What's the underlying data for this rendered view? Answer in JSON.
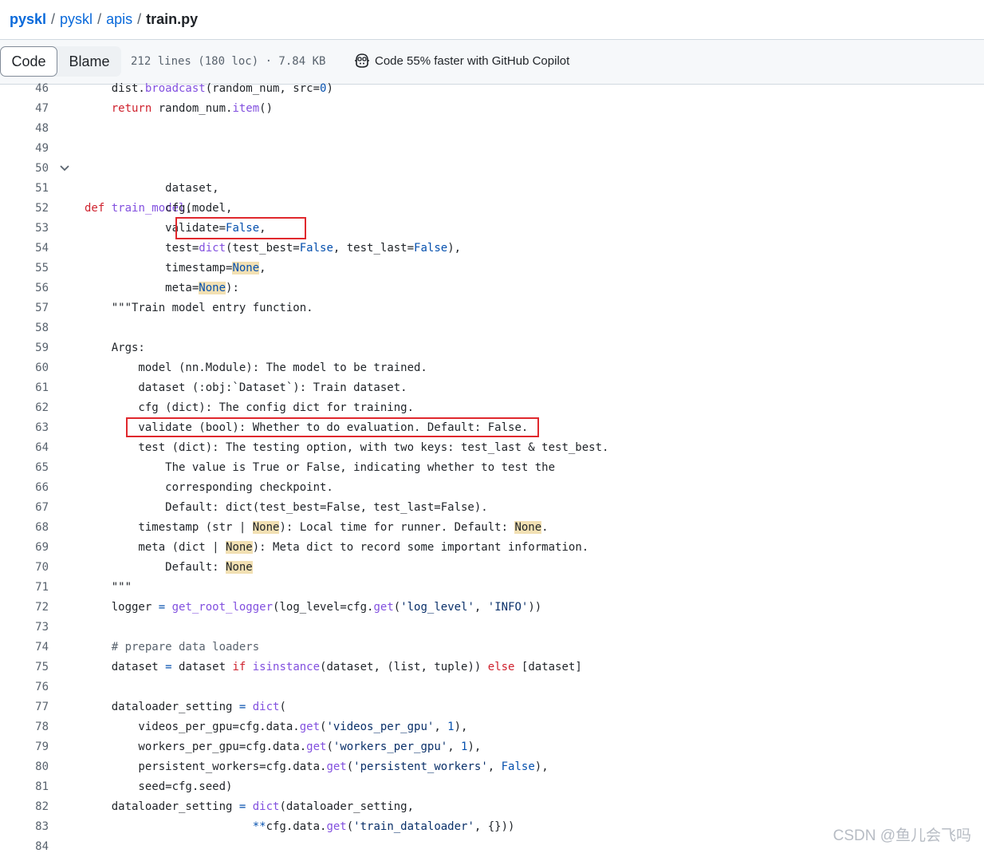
{
  "breadcrumb": {
    "repo": "pyskl",
    "folder": "pyskl",
    "subfolder": "apis",
    "file": "train.py",
    "sep": "/"
  },
  "toolbar": {
    "code_label": "Code",
    "blame_label": "Blame",
    "file_info": "212 lines (180 loc) · 7.84 KB",
    "copilot_label": "Code 55% faster with GitHub Copilot"
  },
  "code": {
    "line_numbers": [
      "46",
      "47",
      "48",
      "49",
      "50",
      "51",
      "52",
      "53",
      "54",
      "55",
      "56",
      "57",
      "58",
      "59",
      "60",
      "61",
      "62",
      "63",
      "64",
      "65",
      "66",
      "67",
      "68",
      "69",
      "70",
      "71",
      "72",
      "73",
      "74",
      "75",
      "76",
      "77",
      "78",
      "79",
      "80",
      "81",
      "82",
      "83",
      "84"
    ],
    "tokens": {
      "l46": [
        "    dist.",
        "broadcast",
        "(random_num, src=",
        "0",
        ")"
      ],
      "l47": [
        "    ",
        "return",
        " random_num.",
        "item",
        "()"
      ],
      "l50": [
        "def",
        " ",
        "train_model",
        "(model,"
      ],
      "l51": "            dataset,",
      "l52": "            cfg,",
      "l53": [
        "            validate=",
        "False",
        ","
      ],
      "l54": [
        "            test=",
        "dict",
        "(test_best=",
        "False",
        ", test_last=",
        "False",
        "),"
      ],
      "l55": [
        "            timestamp=",
        "None",
        ","
      ],
      "l56": [
        "            meta=",
        "None",
        "):"
      ],
      "l57": "    \"\"\"Train model entry function.",
      "l59": "    Args:",
      "l60": "        model (nn.Module): The model to be trained.",
      "l61": "        dataset (:obj:`Dataset`): Train dataset.",
      "l62": "        cfg (dict): The config dict for training.",
      "l63": "        validate (bool): Whether to do evaluation. Default: False.",
      "l64": "        test (dict): The testing option, with two keys: test_last & test_best.",
      "l65": "            The value is True or False, indicating whether to test the",
      "l66": "            corresponding checkpoint.",
      "l67": "            Default: dict(test_best=False, test_last=False).",
      "l68": [
        "        timestamp (str | ",
        "None",
        "): Local time for runner. Default: ",
        "None",
        "."
      ],
      "l69": [
        "        meta (dict | ",
        "None",
        "): Meta dict to record some important information."
      ],
      "l70": [
        "            Default: ",
        "None"
      ],
      "l71": "    \"\"\"",
      "l72": [
        "    logger ",
        "=",
        " ",
        "get_root_logger",
        "(log_level=cfg.",
        "get",
        "(",
        "'log_level'",
        ", ",
        "'INFO'",
        "))"
      ],
      "l74": "    # prepare data loaders",
      "l75": [
        "    dataset ",
        "=",
        " dataset ",
        "if",
        " ",
        "isinstance",
        "(dataset, (list, tuple)) ",
        "else",
        " [dataset]"
      ],
      "l77": [
        "    dataloader_setting ",
        "=",
        " ",
        "dict",
        "("
      ],
      "l78": [
        "        videos_per_gpu=cfg.data.",
        "get",
        "(",
        "'videos_per_gpu'",
        ", ",
        "1",
        "),"
      ],
      "l79": [
        "        workers_per_gpu=cfg.data.",
        "get",
        "(",
        "'workers_per_gpu'",
        ", ",
        "1",
        "),"
      ],
      "l80": [
        "        persistent_workers=cfg.data.",
        "get",
        "(",
        "'persistent_workers'",
        ", ",
        "False",
        "),"
      ],
      "l81": "        seed=cfg.seed)",
      "l82": [
        "    dataloader_setting ",
        "=",
        " ",
        "dict",
        "(dataloader_setting,"
      ],
      "l83": [
        "                         ",
        "**",
        "cfg.data.",
        "get",
        "(",
        "'train_dataloader'",
        ", {}))"
      ]
    }
  },
  "watermark": "CSDN @鱼儿会飞吗",
  "colors": {
    "keyword": "#cf222e",
    "function": "#8250df",
    "builtin": "#0550ae",
    "string": "#0a3069",
    "highlight": "#f2e0b3",
    "annotation_box": "#e0282d"
  }
}
